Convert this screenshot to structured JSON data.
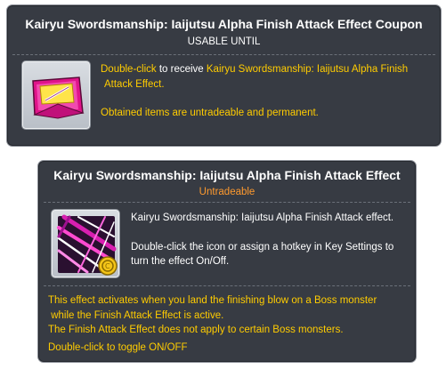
{
  "colors": {
    "panel_bg": "#373b43",
    "highlight_yellow": "#ffcc00",
    "accent_orange": "#ff9a2e",
    "text_white": "#ffffff"
  },
  "coupon": {
    "title": "Kairyu Swordsmanship: Iaijutsu Alpha Finish Attack Effect Coupon",
    "subtitle": "USABLE UNTIL",
    "icon": "pink-coupon-ticket-icon",
    "desc_dblclick": "Double-click",
    "desc_to_receive": " to receive ",
    "desc_item_name_1": "Kairyu Swordsmanship: Iaijutsu Alpha Finish",
    "desc_item_name_2": "Attack Effect.",
    "desc_note": "Obtained items are untradeable and permanent."
  },
  "effect": {
    "title": "Kairyu Swordsmanship: Iaijutsu Alpha Finish Attack Effect",
    "subtitle": "Untradeable",
    "icon": "pink-slash-effect-icon",
    "desc_line1": "Kairyu Swordsmanship: Iaijutsu Alpha Finish Attack effect.",
    "desc_line2": "Double-click the icon or assign a hotkey in Key Settings to",
    "desc_line3": "turn the effect On/Off.",
    "footer_line1": "This effect activates when you land the finishing blow on a Boss monster",
    "footer_line2": " while the Finish Attack Effect is active.",
    "footer_line3": "The Finish Attack Effect does not apply to certain Boss monsters.",
    "footer_line4": "Double-click to toggle ON/OFF"
  }
}
